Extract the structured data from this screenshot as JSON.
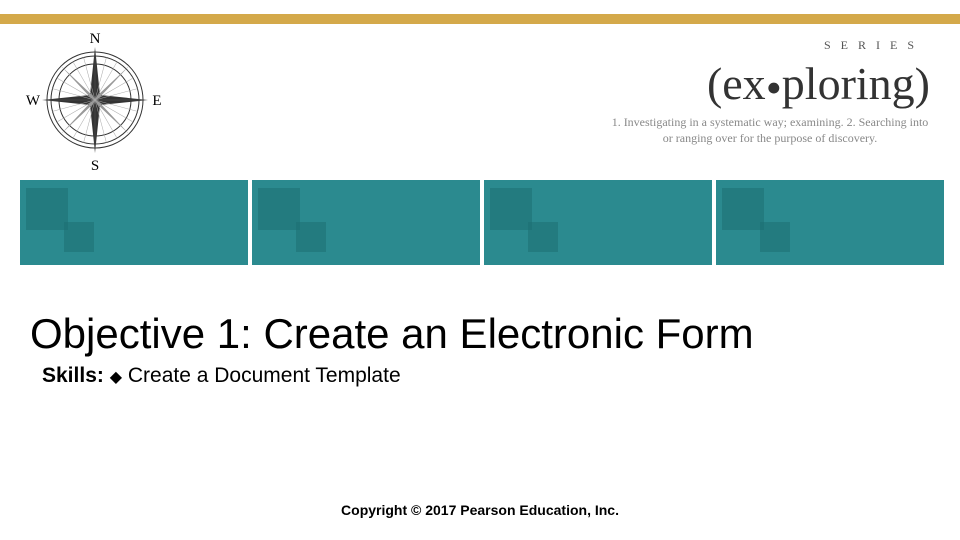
{
  "brand": {
    "series_label": "SERIES",
    "title_prefix": "(ex",
    "title_dot": "•",
    "title_suffix": "ploring)",
    "tagline": "1. Investigating in a systematic way; examining. 2. Searching into or ranging over for the purpose of discovery."
  },
  "compass": {
    "n": "N",
    "e": "E",
    "s": "S",
    "w": "W"
  },
  "main": {
    "title": "Objective 1: Create an Electronic Form",
    "skills_label": "Skills:",
    "skills_bullet": "◆",
    "skills_text": "Create a Document Template"
  },
  "footer": {
    "copyright": "Copyright © 2017 Pearson Education, Inc."
  }
}
